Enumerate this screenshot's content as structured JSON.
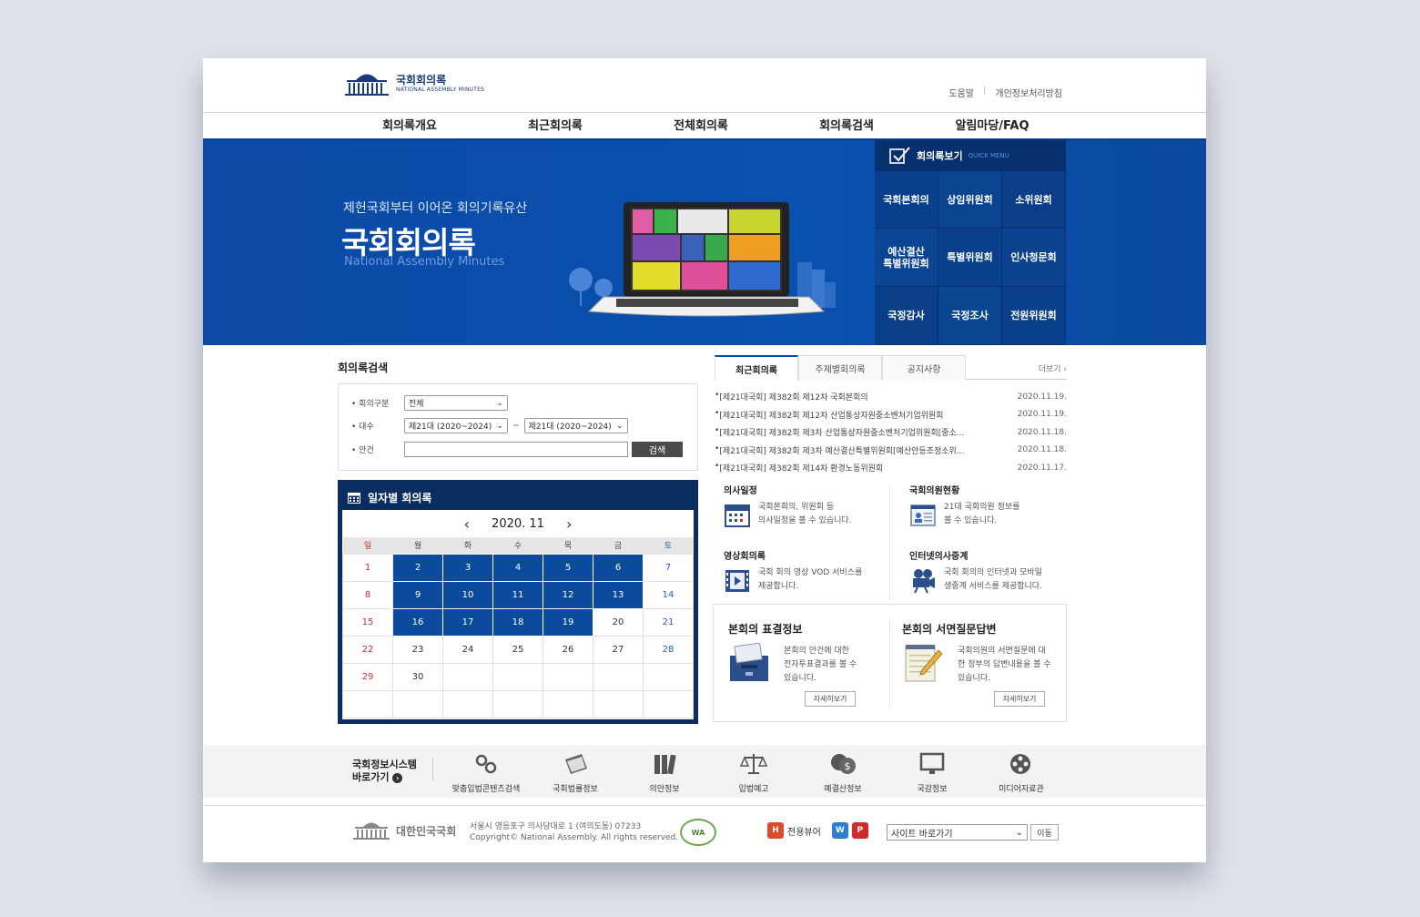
{
  "header": {
    "logo_ko": "국회회의록",
    "logo_en": "NATIONAL ASSEMBLY MINUTES",
    "util_links": [
      "도움말",
      "개인정보처리방침"
    ]
  },
  "nav": [
    "회의록개요",
    "최근회의록",
    "전체회의록",
    "회의록검색",
    "알림마당/FAQ"
  ],
  "hero": {
    "subtitle": "제헌국회부터 이어온 회의기록유산",
    "title": "국회회의록",
    "title_en": "National Assembly Minutes"
  },
  "quick": {
    "title": "회의록보기",
    "title_en": "QUICK MENU",
    "items": [
      "국회본회의",
      "상임위원회",
      "소위원회",
      "예산결산\n특별위원회",
      "특별위원회",
      "인사청문회",
      "국정감사",
      "국정조사",
      "전원위원회"
    ]
  },
  "search": {
    "title": "회의록검색",
    "fields": {
      "type_label": "회의구분",
      "type_value": "전체",
      "term_label": "대수",
      "term_from": "제21대 (2020~2024)",
      "term_sep": "~",
      "term_to": "제21대 (2020~2024)",
      "agenda_label": "안건",
      "agenda_value": ""
    },
    "button": "검색"
  },
  "calendar": {
    "title": "일자별 회의록",
    "month": "2020. 11",
    "weekdays": [
      "일",
      "월",
      "화",
      "수",
      "목",
      "금",
      "토"
    ],
    "weeks": [
      [
        "1",
        "2",
        "3",
        "4",
        "5",
        "6",
        "7"
      ],
      [
        "8",
        "9",
        "10",
        "11",
        "12",
        "13",
        "14"
      ],
      [
        "15",
        "16",
        "17",
        "18",
        "19",
        "20",
        "21"
      ],
      [
        "22",
        "23",
        "24",
        "25",
        "26",
        "27",
        "28"
      ],
      [
        "29",
        "30",
        "",
        "",
        "",
        "",
        ""
      ],
      [
        "",
        "",
        "",
        "",
        "",
        "",
        ""
      ]
    ],
    "meeting_days": [
      "2",
      "3",
      "4",
      "5",
      "6",
      "9",
      "10",
      "11",
      "12",
      "13",
      "16",
      "17",
      "18",
      "19"
    ]
  },
  "tabs": {
    "items": [
      "최근회의록",
      "주제별회의록",
      "공지사항"
    ],
    "active": 0,
    "more": "더보기"
  },
  "news": [
    {
      "title": "[제21대국회] 제382회 제12차 국회본회의",
      "date": "2020.11.19."
    },
    {
      "title": "[제21대국회] 제382회 제12차 산업통상자원중소벤처기업위원회",
      "date": "2020.11.19."
    },
    {
      "title": "[제21대국회] 제382회 제3차 산업통상자원중소벤처기업위원회[중소...",
      "date": "2020.11.18."
    },
    {
      "title": "[제21대국회] 제382회 제3차 예산결산특별위원회[예산안등조정소위...",
      "date": "2020.11.18."
    },
    {
      "title": "[제21대국회] 제382회 제14차 환경노동위원회",
      "date": "2020.11.17."
    }
  ],
  "services": [
    {
      "title": "의사일정",
      "desc": "국회본회의, 위원회 등\n의사일정을 볼 수 있습니다.",
      "icon": "calendar-icon"
    },
    {
      "title": "국회의원현황",
      "desc": "21대 국회의원 정보를\n볼 수 있습니다.",
      "icon": "member-card-icon"
    },
    {
      "title": "영상회의록",
      "desc": "국회 회의 영상 VOD 서비스를\n제공합니다.",
      "icon": "film-icon"
    },
    {
      "title": "인터넷의사중계",
      "desc": "국회 회의의 인터넷과 모바일\n생중계 서비스를 제공합니다.",
      "icon": "camera-icon"
    }
  ],
  "info_boxes": [
    {
      "title": "본회의 표결정보",
      "desc": "본회의 안건에 대한\n전자투표결과를 볼 수\n있습니다.",
      "button": "자세히보기"
    },
    {
      "title": "본회의 서면질문답변",
      "desc": "국회의원의 서면질문에\n대한 정부의 답변내용을\n볼 수 있습니다.",
      "button": "자세히보기"
    }
  ],
  "family": {
    "title_line1": "국회정보시스템",
    "title_line2": "바로가기",
    "items": [
      "맞춤입법콘텐츠검색",
      "국회법률정보",
      "의안정보",
      "입법예고",
      "예결산정보",
      "국감정보",
      "미디어자료관"
    ]
  },
  "footer": {
    "logo": "대한민국국회",
    "address": "서울시 영등포구 의사당대로 1 (여의도동) 07233",
    "copyright": "Copyright© National Assembly. All rights reserved.",
    "wa_mark": "WA",
    "viewer_label": "전용뷰어",
    "site_select": "사이트 바로가기",
    "go_button": "이동"
  },
  "colors": {
    "primary": "#0a4b9e",
    "dark_navy": "#0a2d61",
    "sunday": "#d12a2a",
    "saturday": "#2a5bbf"
  }
}
